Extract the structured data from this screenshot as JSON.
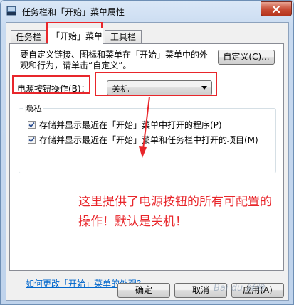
{
  "window": {
    "title": "任务栏和「开始」菜单属性",
    "close_icon": "close-icon"
  },
  "tabs": [
    {
      "label": "任务栏"
    },
    {
      "label": "「开始」菜单"
    },
    {
      "label": "工具栏"
    }
  ],
  "panel": {
    "description": "要自定义链接、图标和菜单在「开始」菜单中的外观和行为，请单击“自定义”。",
    "customize_label": "自定义(C)...",
    "power_label": "电源按钮操作(B)：",
    "power_value": "关机",
    "privacy": {
      "title": "隐私",
      "items": [
        {
          "label": "存储并显示最近在「开始」菜单中打开的程序(P)",
          "checked": true
        },
        {
          "label": "存储并显示最近在「开始」菜单和任务栏中打开的项目(M)",
          "checked": true
        }
      ]
    },
    "help_link": "如何更改「开始」菜单的外观?"
  },
  "annotation": {
    "text": "这里提供了电源按钮的所有可配置的操作！默认是关机！",
    "color": "#e8262b"
  },
  "buttons": {
    "ok": "确定",
    "cancel": "取消",
    "apply": "应用(A)"
  },
  "watermark": "Bai du 经验"
}
